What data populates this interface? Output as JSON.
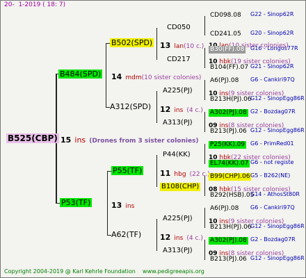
{
  "header": {
    "left": "20-",
    "date": "1-2019 ( 18:  7)"
  },
  "root": {
    "id": "B525(CBP)",
    "num": "15",
    "ins": "ins",
    "note": "(Drones from 3 sister colonies)"
  },
  "gen1": {
    "upper": {
      "id": "B484(SPD)",
      "num": "14",
      "mdm": "mdm",
      "note": "(10 sister colonies)"
    },
    "lower": {
      "id": "P53(TF)",
      "num": "13",
      "ins": "ins"
    }
  },
  "gen2": {
    "a": {
      "id": "B502(SPD)",
      "num": "13",
      "lan": "lan",
      "note": "(10 c.)"
    },
    "b": {
      "id": "A312(SPD)",
      "num": "12",
      "ins": "ins",
      "note": "(4 c.)"
    },
    "c": {
      "id": "P55(TF)",
      "num": "11",
      "hbg": "hbg",
      "note": "(22 c.)"
    },
    "d": {
      "id": "A62(TF)",
      "num": "12",
      "ins": "ins",
      "note": "(4 c.)"
    }
  },
  "gen3": [
    {
      "id": "CD050",
      "num": "10",
      "code": "lan",
      "note": "(10 sister colonies)"
    },
    {
      "id": "CD217",
      "num": "10",
      "code": "hbk",
      "note": "(19 sister colonies)"
    },
    {
      "id": "A225(PJ)",
      "num": "10",
      "code": "ins",
      "note": "(9 sister colonies)"
    },
    {
      "id": "A313(PJ)",
      "num": "09",
      "code": "ins",
      "note": "(8 sister colonies)"
    },
    {
      "id": "P44(KK)",
      "num": "10",
      "code": "hbk",
      "note": "(22 sister colonies)"
    },
    {
      "id": "B108(CHP)",
      "num": "08",
      "code": "hbk",
      "note": "(15 sister colonies)"
    },
    {
      "id": "A225(PJ)",
      "num": "10",
      "code": "ins",
      "note": "(9 sister colonies)"
    },
    {
      "id": "A313(PJ)",
      "num": "09",
      "code": "ins",
      "note": "(8 sister colonies)"
    }
  ],
  "gen4": [
    {
      "id": "CD098.08",
      "tag": "G22 - Sinop62R"
    },
    {
      "id": "CD241.05",
      "tag": "G20 - Sinop62R"
    },
    {
      "id": "B30(FF).08",
      "tag": "G16 - Longos77R"
    },
    {
      "id": "B104(FF).07",
      "tag": "G21 - Sinop62R"
    },
    {
      "id": "A6(PJ).08",
      "tag": "G6 - Cankiri97Q"
    },
    {
      "id": "B213H(PJ).06",
      "tag": "G12 - SinopEgg86R"
    },
    {
      "id": "A302(PJ).08",
      "tag": "G2 - Bozdag07R"
    },
    {
      "id": "B213(PJ).06",
      "tag": "G12 - SinopEgg86R"
    },
    {
      "id": "P25(KK).09",
      "tag": "G6 - PrimRed01"
    },
    {
      "id": "EL74(KK).07",
      "tag": "G6 - not registe"
    },
    {
      "id": "B99(CHP).06",
      "tag": "G5 - B262(NE)"
    },
    {
      "id": "B292(HSB).05",
      "tag": "G14 - AthosSt80R"
    },
    {
      "id": "A6(PJ).08",
      "tag": "G6 - Cankiri97Q"
    },
    {
      "id": "B213H(PJ).06",
      "tag": "G12 - SinopEgg86R"
    },
    {
      "id": "A302(PJ).08",
      "tag": "G2 - Bozdag07R"
    },
    {
      "id": "B213(PJ).06",
      "tag": "G12 - SinopEgg86R"
    }
  ],
  "footer": {
    "copyright": "Copyright 2004-2019 @ Karl Kehrle Foundation",
    "site": "www.pedigreeapis.org"
  },
  "colors": {
    "yellow": "#f0f000",
    "green": "#00e600",
    "pink": "#e8c0e8",
    "grey": "#9a9a9a"
  }
}
